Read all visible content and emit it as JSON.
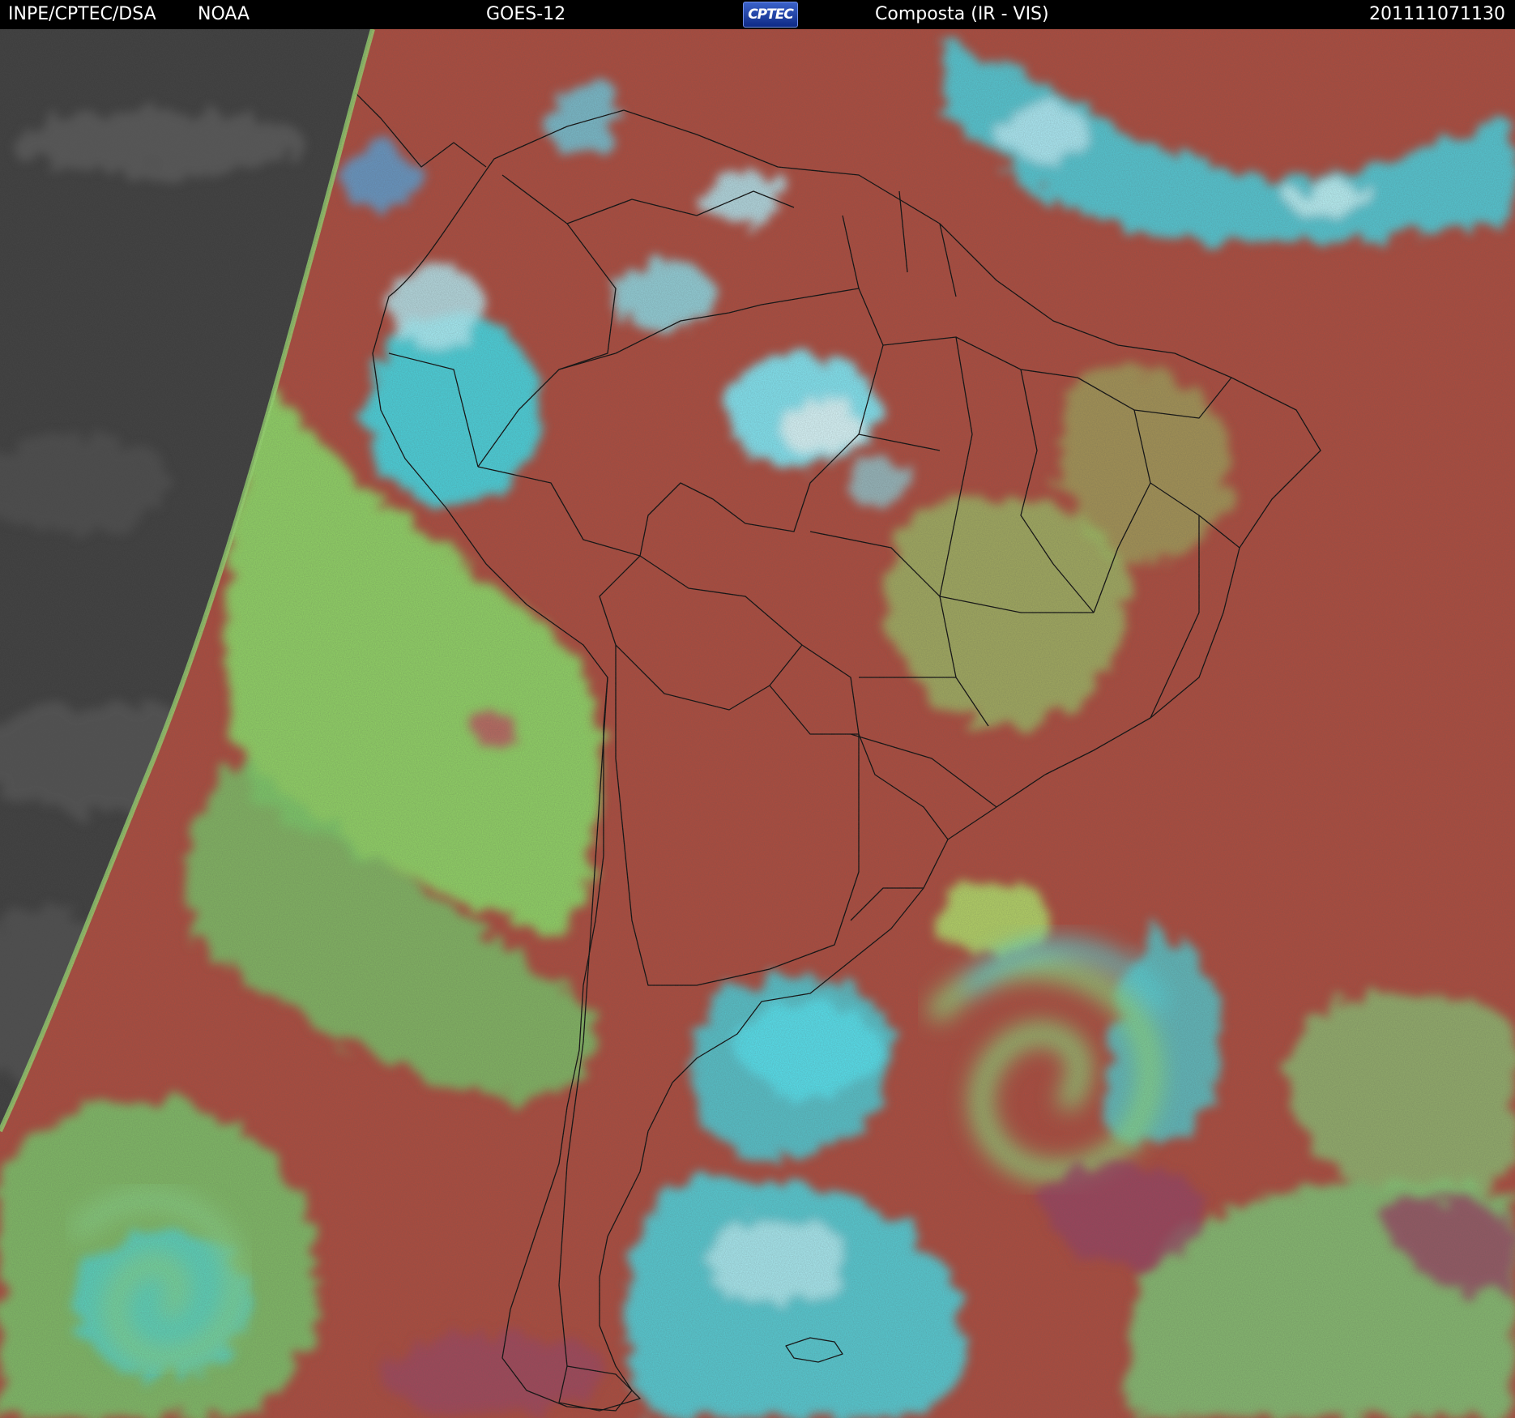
{
  "header": {
    "left_credit": "INPE/CPTEC/DSA",
    "partner": "NOAA",
    "satellite": "GOES-12",
    "logo_text": "CPTEC",
    "product": "Composta (IR - VIS)",
    "timestamp": "201111071130"
  },
  "colors": {
    "background": "#000000",
    "header_text": "#ffffff",
    "clear_land_sea": "#b04a3c",
    "low_cloud": "#8fdc66",
    "high_cloud": "#38e6ee",
    "night_side": "#3c3c3c",
    "borders": "#0a0a0a",
    "logo_blue": "#2448b8"
  }
}
